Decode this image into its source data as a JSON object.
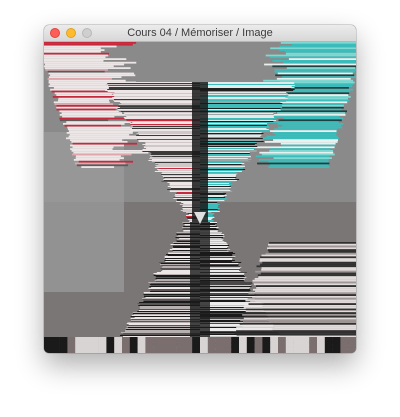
{
  "window": {
    "title": "Cours 04 / Mémoriser / Image"
  },
  "traffic_lights": [
    {
      "name": "close",
      "color": "#fd5f57",
      "border": "#e0443e"
    },
    {
      "name": "minimize",
      "color": "#febb2e",
      "border": "#dea123"
    },
    {
      "name": "zoom",
      "color": "#cfcfcf",
      "border": "#b8b8b8"
    }
  ],
  "canvas": {
    "content": "glitch-feedback-image",
    "colors": {
      "gray": "#8a8a8a",
      "dark": "#1a1a1a",
      "white": "#ece6e6",
      "red": "#c8283c",
      "teal": "#3cbcba",
      "pink": "#e0a6ae"
    }
  }
}
